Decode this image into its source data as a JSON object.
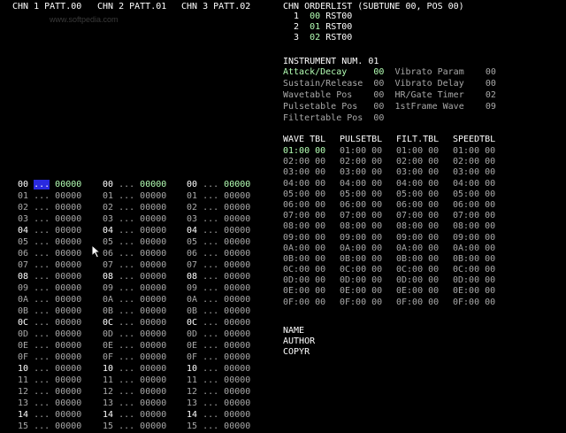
{
  "header": {
    "chn1": "CHN 1 PATT.00",
    "chn2": "CHN 2 PATT.01",
    "chn3": "CHN 3 PATT.02",
    "watermark": "www.softpedia.com"
  },
  "orderlist": {
    "title": "CHN ORDERLIST (SUBTUNE 00, POS 00)",
    "rows": [
      {
        "n": "1",
        "pos": "00",
        "cmd": "RST00"
      },
      {
        "n": "2",
        "pos": "01",
        "cmd": "RST00"
      },
      {
        "n": "3",
        "pos": "02",
        "cmd": "RST00"
      }
    ]
  },
  "instrument": {
    "title": "INSTRUMENT NUM. 01",
    "rows": [
      {
        "l1": "Attack/Decay",
        "v1": "00",
        "l2": "Vibrato Param",
        "v2": "00",
        "hl": true
      },
      {
        "l1": "Sustain/Release",
        "v1": "00",
        "l2": "Vibrato Delay",
        "v2": "00"
      },
      {
        "l1": "Wavetable Pos",
        "v1": "00",
        "l2": "HR/Gate Timer",
        "v2": "02"
      },
      {
        "l1": "Pulsetable Pos",
        "v1": "00",
        "l2": "1stFrame Wave",
        "v2": "09"
      },
      {
        "l1": "Filtertable Pos",
        "v1": "00",
        "l2": "",
        "v2": ""
      }
    ]
  },
  "tables": {
    "headers": [
      "WAVE TBL",
      "PULSETBL",
      "FILT.TBL",
      "SPEEDTBL"
    ],
    "rows": [
      "01:00 00",
      "02:00 00",
      "03:00 00",
      "04:00 00",
      "05:00 00",
      "06:00 00",
      "07:00 00",
      "08:00 00",
      "09:00 00",
      "0A:00 00",
      "0B:00 00",
      "0C:00 00",
      "0D:00 00",
      "0E:00 00",
      "0F:00 00"
    ]
  },
  "song": {
    "name": "NAME",
    "author": "AUTHOR",
    "copyright": "COPYR"
  },
  "pattern": {
    "rows": [
      "00",
      "01",
      "02",
      "03",
      "04",
      "05",
      "06",
      "07",
      "08",
      "09",
      "0A",
      "0B",
      "0C",
      "0D",
      "0E",
      "0F",
      "10",
      "11",
      "12",
      "13",
      "14",
      "15"
    ],
    "note": "...",
    "cmd": "00000"
  }
}
